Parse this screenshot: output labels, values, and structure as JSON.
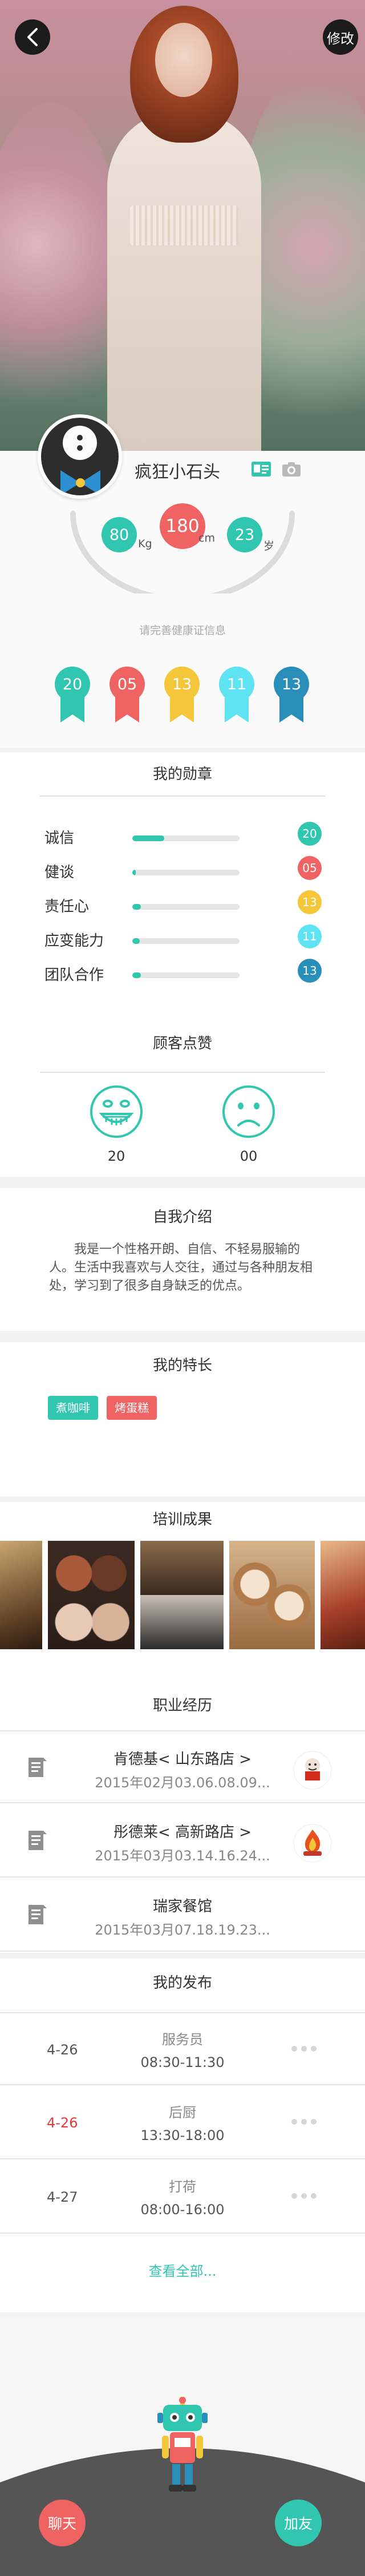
{
  "header": {
    "edit_label": "修改"
  },
  "profile": {
    "nickname": "疯狂小石头",
    "weight": "80",
    "weight_unit": "Kg",
    "height": "180",
    "height_unit": "cm",
    "age": "23",
    "age_unit": "岁",
    "health_tip": "请完善健康证信息",
    "badges": [
      {
        "value": "20",
        "color": "#31c6b0"
      },
      {
        "value": "05",
        "color": "#f06363"
      },
      {
        "value": "13",
        "color": "#f4c73b"
      },
      {
        "value": "11",
        "color": "#5ee3f3"
      },
      {
        "value": "13",
        "color": "#2a8fb8"
      }
    ]
  },
  "medals": {
    "title": "我的勋章",
    "items": [
      {
        "label": "诚信",
        "value": "20",
        "progress": 0.3,
        "color": "#31c6b0"
      },
      {
        "label": "健谈",
        "value": "05",
        "progress": 0.03,
        "color": "#f06363"
      },
      {
        "label": "责任心",
        "value": "13",
        "progress": 0.08,
        "color": "#f4c73b"
      },
      {
        "label": "应变能力",
        "value": "11",
        "progress": 0.07,
        "color": "#5ee3f3"
      },
      {
        "label": "团队合作",
        "value": "13",
        "progress": 0.08,
        "color": "#2a8fb8"
      }
    ]
  },
  "likes": {
    "title": "顾客点赞",
    "happy_count": "20",
    "sad_count": "00"
  },
  "intro": {
    "title": "自我介绍",
    "text": "我是一个性格开朗、自信、不轻易服输的人。生活中我喜欢与人交往，通过与各种朋友相处，学习到了很多自身缺乏的优点。"
  },
  "skills": {
    "title": "我的特长",
    "tags": [
      {
        "label": "煮咖啡",
        "color": "#31c6b0"
      },
      {
        "label": "烤蛋糕",
        "color": "#f06363"
      }
    ]
  },
  "training": {
    "title": "培训成果"
  },
  "career": {
    "title": "职业经历",
    "items": [
      {
        "name": "肯德基< 山东路店 >",
        "date": "2015年02月03.06.08.09..."
      },
      {
        "name": "彤德莱< 高新路店 >",
        "date": "2015年03月03.14.16.24..."
      },
      {
        "name": "瑞家餐馆",
        "date": "2015年03月07.18.19.23..."
      }
    ]
  },
  "posts": {
    "title": "我的发布",
    "items": [
      {
        "date": "4-26",
        "role": "服务员",
        "time": "08:30-11:30",
        "highlight": false
      },
      {
        "date": "4-26",
        "role": "后厨",
        "time": "13:30-18:00",
        "highlight": true
      },
      {
        "date": "4-27",
        "role": "打荷",
        "time": "08:00-16:00",
        "highlight": false
      }
    ],
    "view_all": "查看全部..."
  },
  "footer": {
    "chat_label": "聊天",
    "add_friend_label": "加友"
  }
}
